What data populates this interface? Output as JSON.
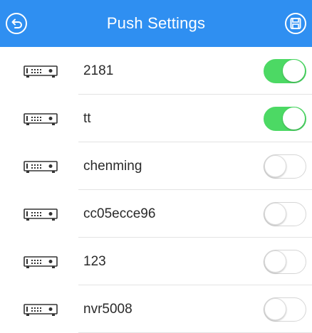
{
  "header": {
    "title": "Push Settings",
    "background": "#2f8ff1",
    "back_icon": "back-arrow-icon",
    "save_icon": "save-icon"
  },
  "colors": {
    "toggle_on": "#4cd964",
    "toggle_off": "#ffffff"
  },
  "devices": [
    {
      "name": "2181",
      "push_enabled": true
    },
    {
      "name": "tt",
      "push_enabled": true
    },
    {
      "name": "chenming",
      "push_enabled": false
    },
    {
      "name": "cc05ecce96",
      "push_enabled": false
    },
    {
      "name": "123",
      "push_enabled": false
    },
    {
      "name": "nvr5008",
      "push_enabled": false
    }
  ],
  "device_icon": "dvr-device-icon"
}
